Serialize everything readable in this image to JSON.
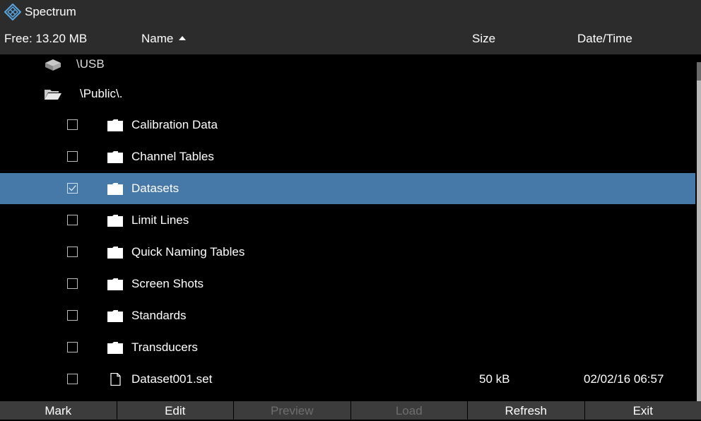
{
  "titlebar": {
    "title": "Spectrum",
    "logo_icon": "rohde-schwarz-diamond-logo"
  },
  "header": {
    "free": "Free: 13.20 MB",
    "name_col": "Name",
    "size_col": "Size",
    "date_col": "Date/Time"
  },
  "tree": {
    "drive_label": "\\USB",
    "public_label": "\\Public\\."
  },
  "files": [
    {
      "name": "Calibration Data",
      "type": "folder",
      "checked": false,
      "size": "",
      "date": ""
    },
    {
      "name": "Channel Tables",
      "type": "folder",
      "checked": false,
      "size": "",
      "date": ""
    },
    {
      "name": "Datasets",
      "type": "folder",
      "checked": true,
      "size": "",
      "date": ""
    },
    {
      "name": "Limit Lines",
      "type": "folder",
      "checked": false,
      "size": "",
      "date": ""
    },
    {
      "name": "Quick Naming Tables",
      "type": "folder",
      "checked": false,
      "size": "",
      "date": ""
    },
    {
      "name": "Screen Shots",
      "type": "folder",
      "checked": false,
      "size": "",
      "date": ""
    },
    {
      "name": "Standards",
      "type": "folder",
      "checked": false,
      "size": "",
      "date": ""
    },
    {
      "name": "Transducers",
      "type": "folder",
      "checked": false,
      "size": "",
      "date": ""
    },
    {
      "name": "Dataset001.set",
      "type": "file",
      "checked": false,
      "size": "50 kB",
      "date": "02/02/16 06:57"
    }
  ],
  "softkeys": [
    {
      "label": "Mark",
      "enabled": true
    },
    {
      "label": "Edit",
      "enabled": true
    },
    {
      "label": "Preview",
      "enabled": false
    },
    {
      "label": "Load",
      "enabled": false
    },
    {
      "label": "Refresh",
      "enabled": true
    },
    {
      "label": "Exit",
      "enabled": true
    }
  ],
  "colors": {
    "selection": "#4679a8",
    "bar": "#2c2c2c",
    "softkey": "#3c3c3c",
    "accent": "#5aa6e0"
  }
}
